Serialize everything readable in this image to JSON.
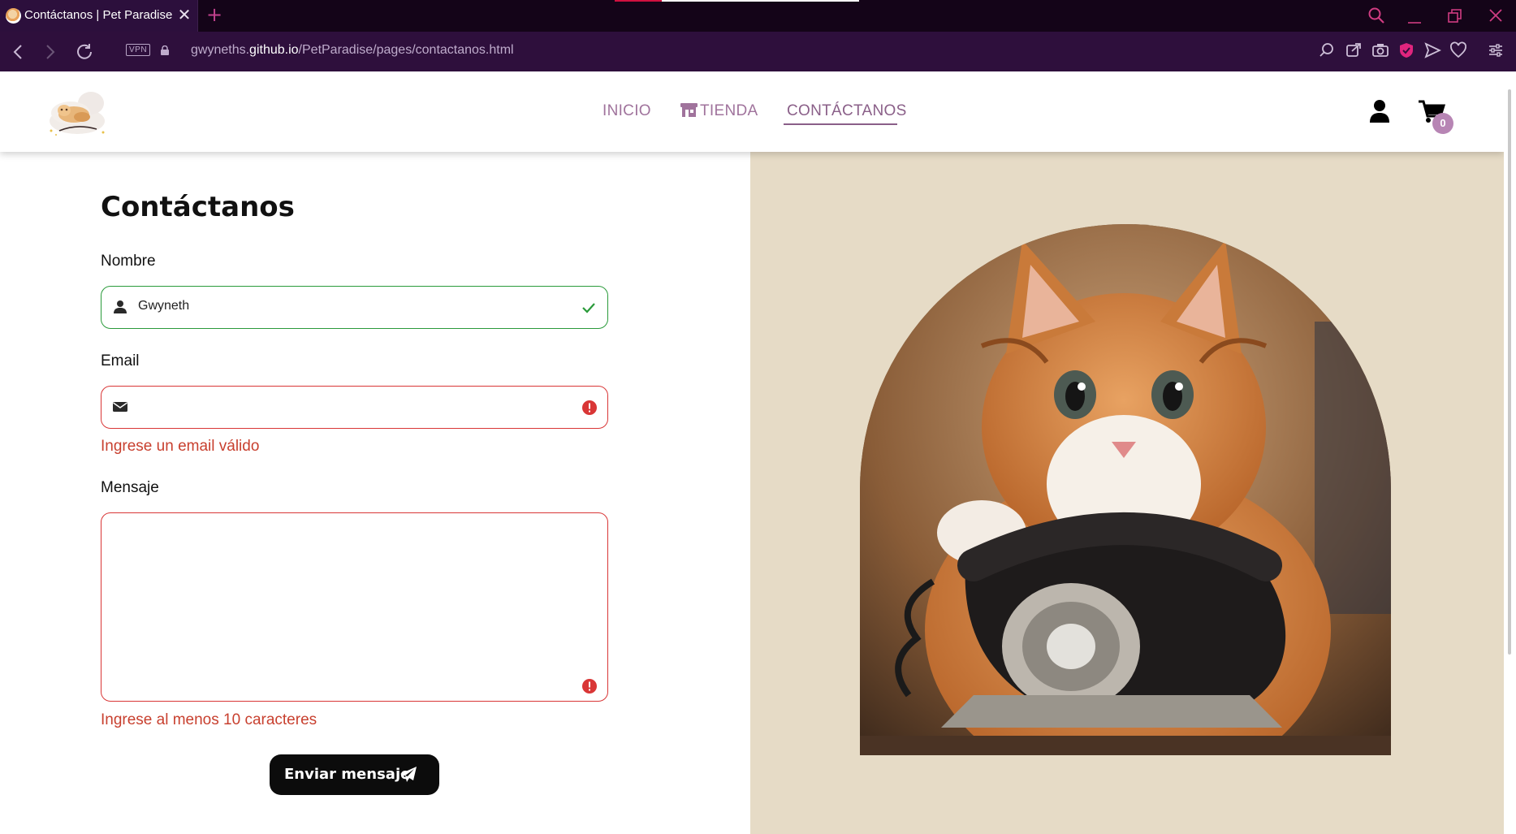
{
  "browser": {
    "tab_title": "Contáctanos | Pet Paradise",
    "tab_close_glyph": "✕",
    "new_tab_glyph": "+",
    "vpn_badge": "VPN",
    "url_prefix": "gwyneths.",
    "url_domain": "github.io",
    "url_path": "/PetParadise/pages/contactanos.html",
    "icons": [
      "back-icon",
      "forward-icon",
      "reload-icon",
      "lock-icon",
      "search-icon",
      "share-icon",
      "camera-icon",
      "shield-icon",
      "send-icon",
      "heart-icon",
      "settings-icon",
      "minimize-icon",
      "restore-icon",
      "close-icon"
    ]
  },
  "header": {
    "logo_alt": "Pet Paradise",
    "nav": [
      {
        "label": "INICIO"
      },
      {
        "label": "TIENDA"
      },
      {
        "label": "CONTÁCTANOS"
      }
    ],
    "cart_count": "0",
    "colors": {
      "nav": "#a0739c",
      "nav_active": "#8a5f88",
      "badge": "#b785b4"
    }
  },
  "form": {
    "title": "Contáctanos",
    "name_label": "Nombre",
    "name_value": "Gwyneth",
    "email_label": "Email",
    "email_value": "",
    "email_error": "Ingrese un email válido",
    "message_label": "Mensaje",
    "message_value": "",
    "message_error": "Ingrese al menos 10 caracteres",
    "submit_label": "Enviar mensaje",
    "colors": {
      "valid": "#2a9a3a",
      "invalid": "#d93636",
      "error_text": "#c8402f",
      "button": "#0c0c0c"
    }
  },
  "side_panel": {
    "background": "#e6dbc6",
    "image_subject": "orange and white cat with a black rotary telephone"
  }
}
